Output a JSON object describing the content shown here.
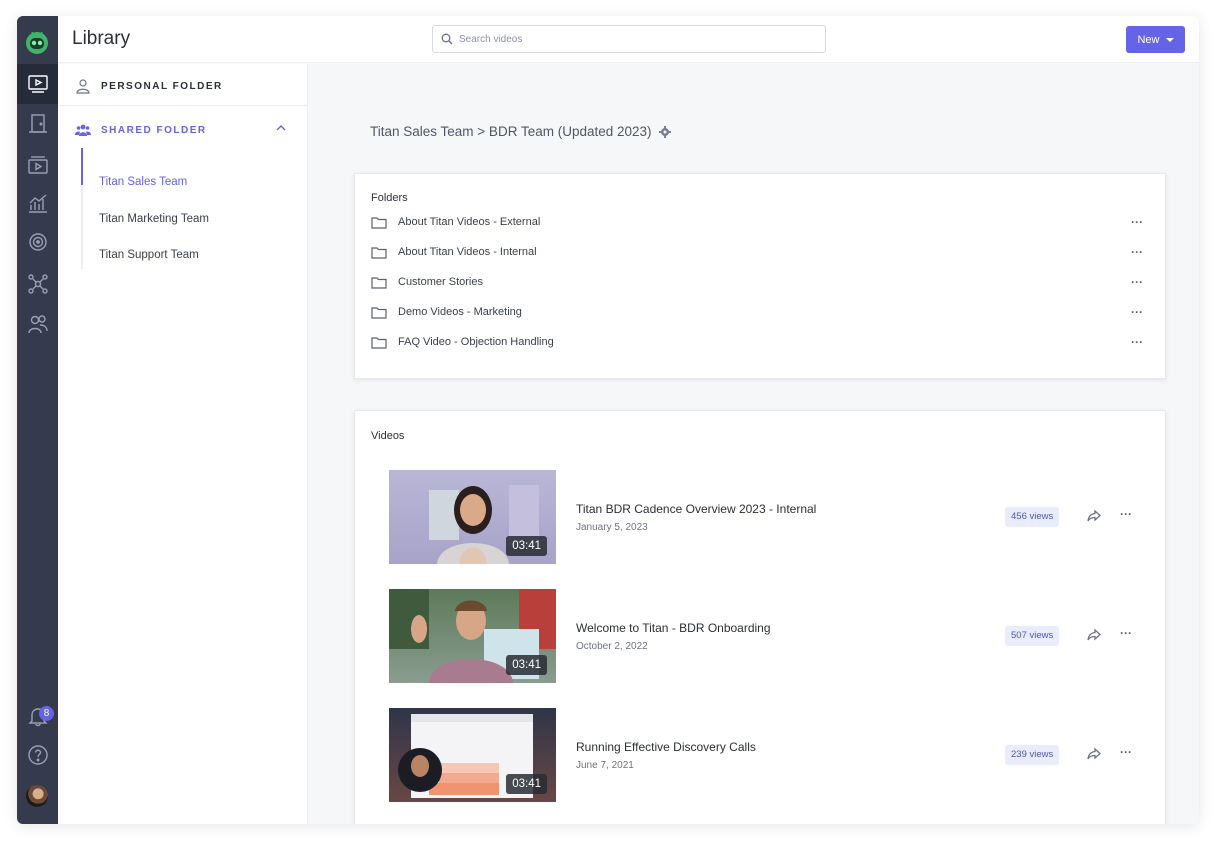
{
  "header": {
    "title": "Library",
    "search_placeholder": "Search videos",
    "new_button": "New"
  },
  "rail": {
    "notifications_count": "8"
  },
  "sidebar": {
    "personal_label": "PERSONAL FOLDER",
    "shared_label": "SHARED FOLDER",
    "items": [
      {
        "label": "Titan Sales Team",
        "active": true
      },
      {
        "label": "Titan Marketing Team",
        "active": false
      },
      {
        "label": "Titan Support Team",
        "active": false
      }
    ]
  },
  "main": {
    "breadcrumb": "Titan Sales Team > BDR Team (Updated 2023)",
    "folders_title": "Folders",
    "folders": [
      "About Titan Videos - External",
      "About Titan Videos - Internal",
      "Customer Stories",
      "Demo Videos - Marketing",
      "FAQ Video - Objection Handling"
    ],
    "videos_title": "Videos",
    "videos": [
      {
        "title": "Titan BDR Cadence Overview 2023 - Internal",
        "date": "January 5, 2023",
        "views": "456 views",
        "duration": "03:41"
      },
      {
        "title": "Welcome to Titan - BDR Onboarding",
        "date": "October 2, 2022",
        "views": "507 views",
        "duration": "03:41"
      },
      {
        "title": "Running Effective Discovery Calls",
        "date": "June 7, 2021",
        "views": "239 views",
        "duration": "03:41"
      }
    ]
  },
  "colors": {
    "accent": "#6563e8",
    "rail": "#353b4d",
    "views_badge": "#e9ecfb"
  }
}
